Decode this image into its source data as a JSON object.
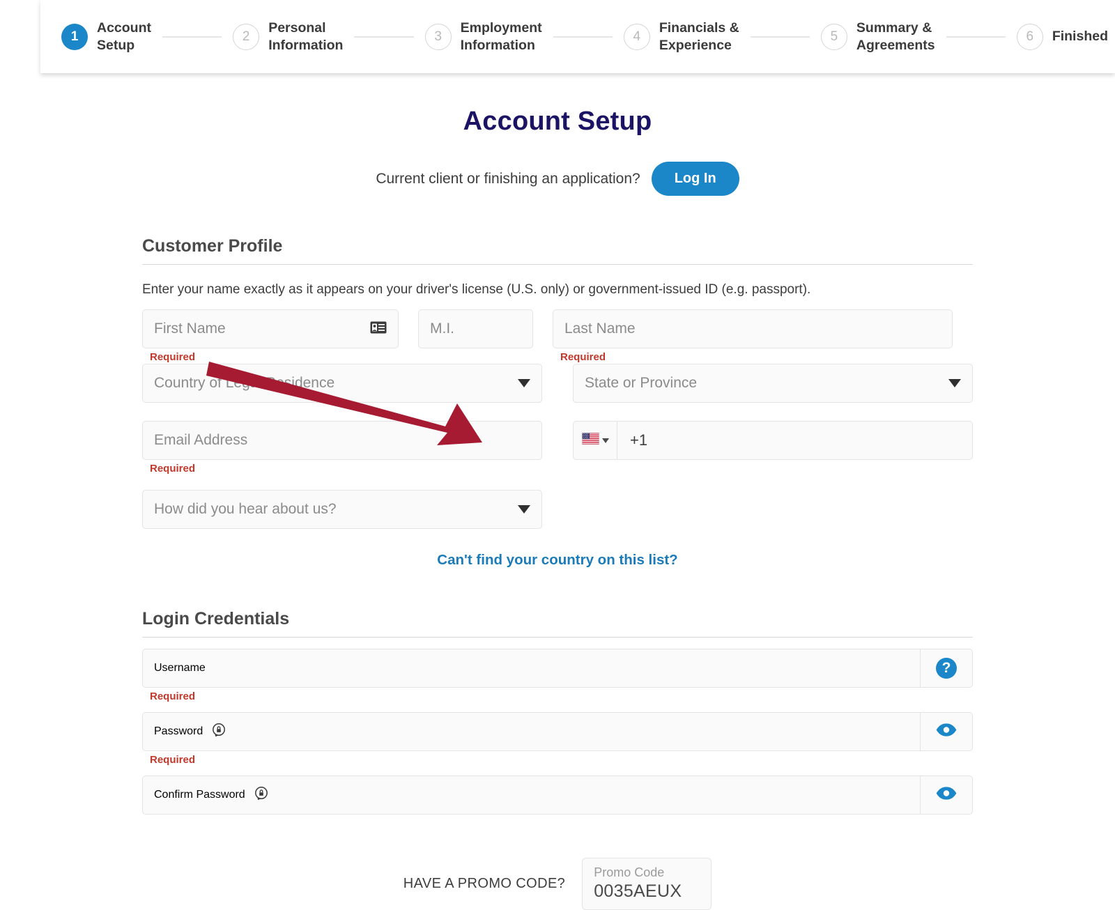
{
  "stepper": {
    "steps": [
      {
        "number": "1",
        "label": "Account\nSetup",
        "state": "active"
      },
      {
        "number": "2",
        "label": "Personal\nInformation",
        "state": "idle"
      },
      {
        "number": "3",
        "label": "Employment\nInformation",
        "state": "idle"
      },
      {
        "number": "4",
        "label": "Financials &\nExperience",
        "state": "idle"
      },
      {
        "number": "5",
        "label": "Summary &\nAgreements",
        "state": "idle"
      },
      {
        "number": "6",
        "label": "Finished",
        "state": "idle"
      }
    ]
  },
  "page": {
    "title": "Account Setup"
  },
  "login": {
    "question": "Current client or finishing an application?",
    "button_label": "Log In"
  },
  "customer_profile": {
    "heading": "Customer Profile",
    "helper_text": "Enter your name exactly as it appears on your driver's license (U.S. only) or government-issued ID (e.g. passport).",
    "first_name": {
      "placeholder": "First Name",
      "value": "",
      "required_text": "Required",
      "icon": "id-card-icon"
    },
    "middle_initial": {
      "placeholder": "M.I.",
      "value": ""
    },
    "last_name": {
      "placeholder": "Last Name",
      "value": "",
      "required_text": "Required"
    },
    "country": {
      "placeholder": "Country of Legal Residence",
      "value": ""
    },
    "state": {
      "placeholder": "State or Province",
      "value": ""
    },
    "email": {
      "placeholder": "Email Address",
      "value": "",
      "required_text": "Required"
    },
    "phone": {
      "country_flag": "us-flag-icon",
      "value": "+1"
    },
    "hear_about_us": {
      "placeholder": "How did you hear about us?",
      "value": ""
    },
    "country_link": "Can't find your country on this list?"
  },
  "login_credentials": {
    "heading": "Login Credentials",
    "username": {
      "placeholder": "Username",
      "value": "",
      "required_text": "Required",
      "action_icon": "question-mark-icon"
    },
    "password": {
      "placeholder": "Password",
      "value": "",
      "required_text": "Required",
      "inline_icon": "password-manager-icon",
      "action_icon": "eye-icon"
    },
    "confirm_password": {
      "placeholder": "Confirm Password",
      "value": "",
      "inline_icon": "password-manager-icon",
      "action_icon": "eye-icon"
    }
  },
  "promo": {
    "label": "HAVE A PROMO CODE?",
    "field_caption": "Promo Code",
    "field_value": "0035AEUX"
  },
  "annotation": {
    "type": "arrow",
    "color": "#A61B31",
    "points_to": "HAVE A PROMO CODE?"
  },
  "colors": {
    "accent_blue": "#1b86c8",
    "title_navy": "#1b1464",
    "link_blue": "#1b7bb9",
    "required_red": "#c0392b",
    "arrow_red": "#A61B31"
  }
}
